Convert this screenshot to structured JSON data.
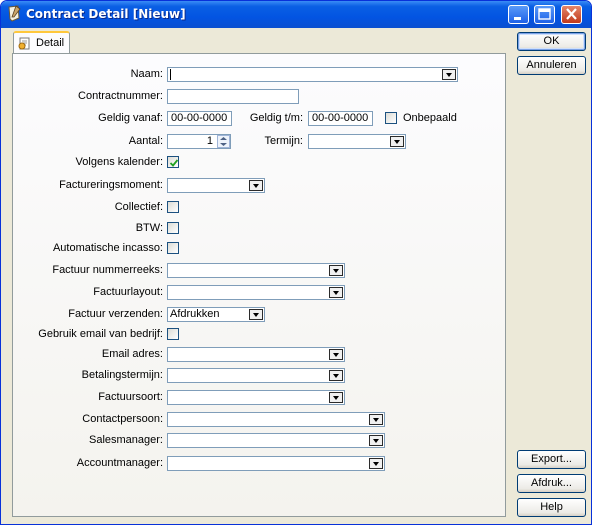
{
  "window": {
    "title": "Contract Detail [Nieuw]"
  },
  "tabs": [
    {
      "label": "Detail"
    }
  ],
  "form": {
    "naam": {
      "label": "Naam:",
      "value": ""
    },
    "contractnummer": {
      "label": "Contractnummer:",
      "value": ""
    },
    "geldig_vanaf": {
      "label": "Geldig vanaf:",
      "value": "00-00-0000"
    },
    "geldig_tm": {
      "label": "Geldig t/m:",
      "value": "00-00-0000"
    },
    "onbepaald": {
      "label": "Onbepaald",
      "checked": false
    },
    "aantal": {
      "label": "Aantal:",
      "value": "1"
    },
    "termijn": {
      "label": "Termijn:",
      "value": ""
    },
    "volgens_kalender": {
      "label": "Volgens kalender:",
      "checked": true
    },
    "factureringsmoment": {
      "label": "Factureringsmoment:",
      "value": ""
    },
    "collectief": {
      "label": "Collectief:",
      "checked": false
    },
    "btw": {
      "label": "BTW:",
      "checked": false
    },
    "automatische_incasso": {
      "label": "Automatische incasso:",
      "checked": false
    },
    "factuur_nummerreeks": {
      "label": "Factuur nummerreeks:",
      "value": ""
    },
    "factuurlayout": {
      "label": "Factuurlayout:",
      "value": ""
    },
    "factuur_verzenden": {
      "label": "Factuur verzenden:",
      "value": "Afdrukken"
    },
    "gebruik_email": {
      "label": "Gebruik email van bedrijf:",
      "checked": false
    },
    "email_adres": {
      "label": "Email adres:",
      "value": ""
    },
    "betalingstermijn": {
      "label": "Betalingstermijn:",
      "value": ""
    },
    "factuursoort": {
      "label": "Factuursoort:",
      "value": ""
    },
    "contactpersoon": {
      "label": "Contactpersoon:",
      "value": ""
    },
    "salesmanager": {
      "label": "Salesmanager:",
      "value": ""
    },
    "accountmanager": {
      "label": "Accountmanager:",
      "value": ""
    }
  },
  "buttons": {
    "ok": "OK",
    "annuleren": "Annuleren",
    "export": "Export...",
    "afdruk": "Afdruk...",
    "help": "Help"
  },
  "colors": {
    "titlebar": "#0a5fe4",
    "window_bg": "#ece9d8",
    "field_border": "#7f9db9",
    "tab_highlight": "#ffc83c"
  }
}
